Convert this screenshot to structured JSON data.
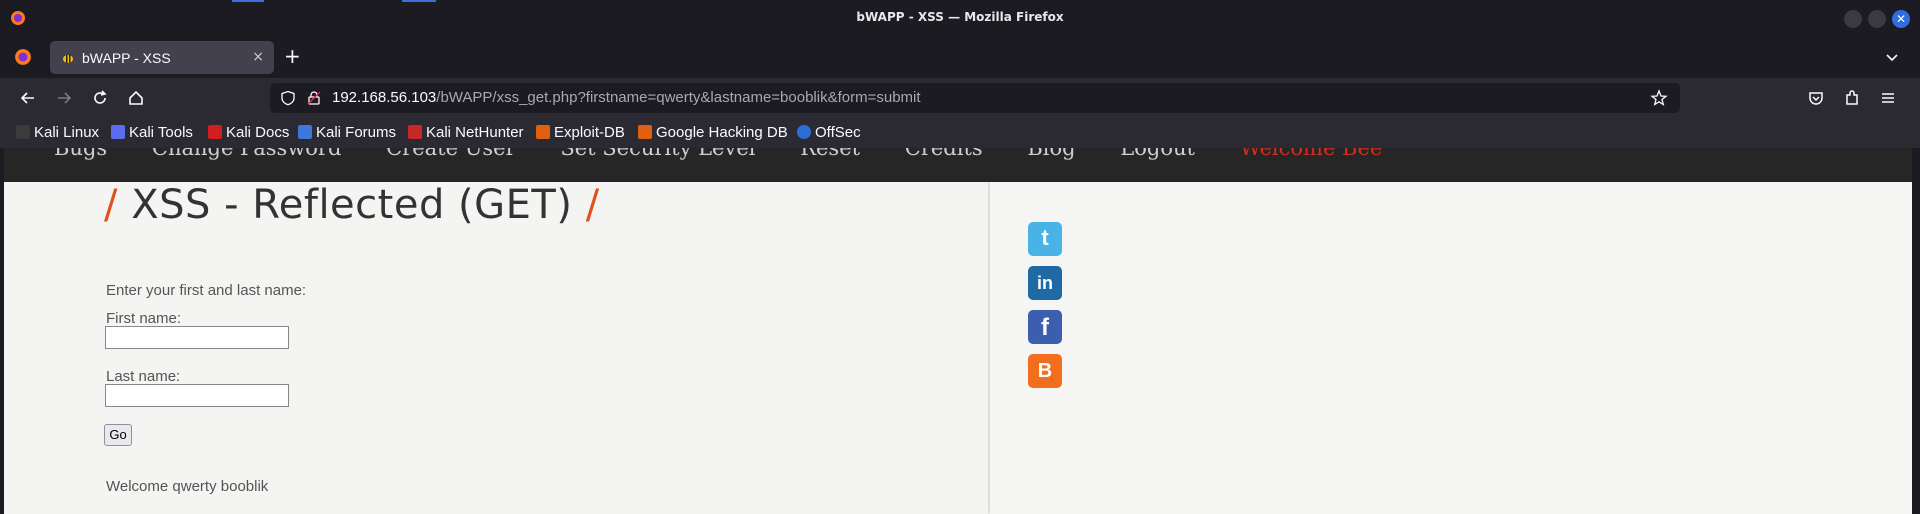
{
  "window": {
    "title": "bWAPP - XSS — Mozilla Firefox"
  },
  "tab": {
    "label": "bWAPP - XSS",
    "close_glyph": "×"
  },
  "new_tab_glyph": "+",
  "address": {
    "host": "192.168.56.103",
    "path": "/bWAPP/xss_get.php?firstname=qwerty&lastname=booblik&form=submit"
  },
  "bookmarks": [
    {
      "label": "Kali Linux",
      "icon": "kali-dragon-icon",
      "color": "#3b3b3b"
    },
    {
      "label": "Kali Tools",
      "icon": "kali-tools-icon",
      "color": "#5a6cf0"
    },
    {
      "label": "Kali Docs",
      "icon": "kali-docs-icon",
      "color": "#d11f1f"
    },
    {
      "label": "Kali Forums",
      "icon": "kali-forums-icon",
      "color": "#3d79d8"
    },
    {
      "label": "Kali NetHunter",
      "icon": "kali-nethunter-icon",
      "color": "#c62828"
    },
    {
      "label": "Exploit-DB",
      "icon": "exploit-db-icon",
      "color": "#e06010"
    },
    {
      "label": "Google Hacking DB",
      "icon": "ghdb-icon",
      "color": "#e06010"
    },
    {
      "label": "OffSec",
      "icon": "offsec-icon",
      "color": "#2a6fd8"
    }
  ],
  "site_menu": [
    "Bugs",
    "Change Password",
    "Create User",
    "Set Security Level",
    "Reset",
    "Credits",
    "Blog",
    "Logout",
    "Welcome Bee"
  ],
  "page": {
    "title": "XSS - Reflected (GET)",
    "slash": "/",
    "intro": "Enter your first and last name:",
    "first_name_label": "First name:",
    "last_name_label": "Last name:",
    "go_label": "Go",
    "welcome": "Welcome qwerty booblik"
  },
  "social": [
    {
      "name": "twitter",
      "glyph": "t",
      "color": "#4ab3e6"
    },
    {
      "name": "linkedin",
      "glyph": "in",
      "color": "#1f6aa5"
    },
    {
      "name": "facebook",
      "glyph": "f",
      "color": "#3b5fae"
    },
    {
      "name": "blogger",
      "glyph": "B",
      "color": "#f26d1c"
    }
  ]
}
